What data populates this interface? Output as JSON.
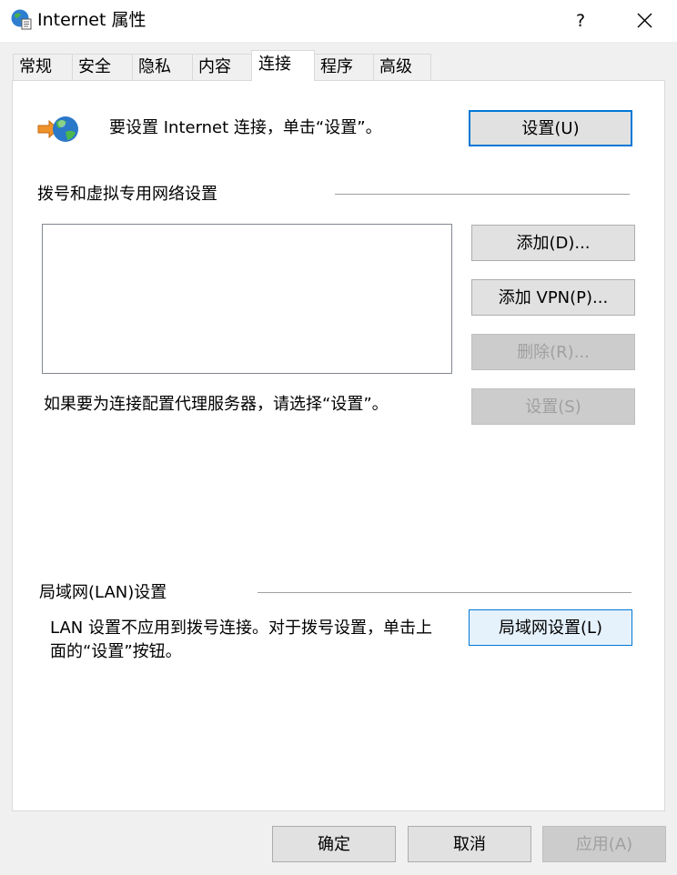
{
  "window": {
    "title": "Internet 属性",
    "help_glyph": "?",
    "close_glyph": "✕"
  },
  "tabs": [
    {
      "label": "常规"
    },
    {
      "label": "安全"
    },
    {
      "label": "隐私"
    },
    {
      "label": "内容"
    },
    {
      "label": "连接",
      "active": true
    },
    {
      "label": "程序"
    },
    {
      "label": "高级"
    }
  ],
  "connect": {
    "setup_text": "要设置 Internet 连接，单击“设置”。",
    "setup_button": "设置(U)"
  },
  "dialup": {
    "group_label": "拨号和虚拟专用网络设置",
    "add_button": "添加(D)...",
    "add_vpn_button": "添加 VPN(P)...",
    "remove_button": "删除(R)...",
    "settings_button": "设置(S)",
    "proxy_text": "如果要为连接配置代理服务器，请选择“设置”。"
  },
  "lan": {
    "group_label": "局域网(LAN)设置",
    "text_line1": "LAN 设置不应用到拨号连接。对于拨号设置，单击上",
    "text_line2": "面的“设置”按钮。",
    "button": "局域网设置(L)"
  },
  "footer": {
    "ok": "确定",
    "cancel": "取消",
    "apply": "应用(A)"
  },
  "colors": {
    "accent": "#0078d7",
    "disabled_text": "#a0a0a0"
  }
}
